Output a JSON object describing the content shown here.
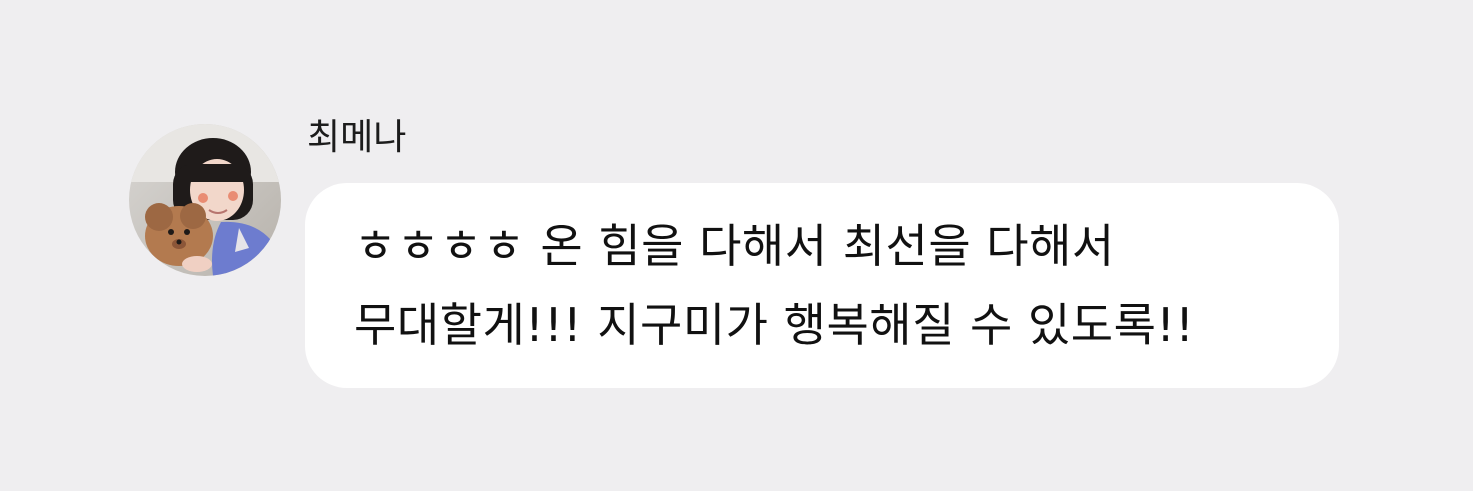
{
  "chat": {
    "sender": {
      "name": "최메나",
      "avatar_icon": "profile-photo-icon"
    },
    "message": {
      "lines": [
        "ㅎㅎㅎㅎ 온 힘을 다해서 최선을 다해서",
        "무대할게!!! 지구미가 행복해질 수 있도록!!"
      ]
    }
  },
  "colors": {
    "background": "#efeef0",
    "bubble": "#ffffff",
    "text": "#111111"
  }
}
